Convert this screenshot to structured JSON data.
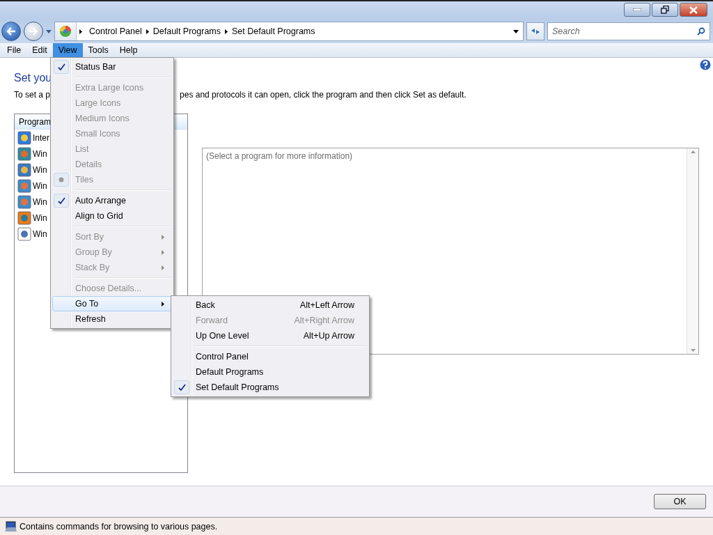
{
  "address_bar": {
    "breadcrumbs": [
      "Control Panel",
      "Default Programs",
      "Set Default Programs"
    ]
  },
  "search": {
    "placeholder": "Search"
  },
  "menu_bar": [
    {
      "label": "File",
      "selected": false
    },
    {
      "label": "Edit",
      "selected": false
    },
    {
      "label": "View",
      "selected": true
    },
    {
      "label": "Tools",
      "selected": false
    },
    {
      "label": "Help",
      "selected": false
    }
  ],
  "page": {
    "heading": "Set you",
    "description_left": "To set a p",
    "description_right": "pes and protocols it can open, click the program and then click Set as default.",
    "program_list": {
      "header": "Program",
      "items": [
        {
          "name": "Inter",
          "kind": "browser"
        },
        {
          "name": "Win",
          "kind": "gallery"
        },
        {
          "name": "Win",
          "kind": "contacts"
        },
        {
          "name": "Win",
          "kind": "mail"
        },
        {
          "name": "Win",
          "kind": "mail"
        },
        {
          "name": "Win",
          "kind": "player"
        },
        {
          "name": "Win",
          "kind": "document"
        }
      ]
    },
    "info_box": {
      "placeholder": "(Select a program for more information)"
    },
    "ok_button": "OK"
  },
  "view_menu": [
    [
      {
        "label": "Status Bar",
        "kind": "check",
        "checked": true,
        "disabled": false,
        "selected": false
      }
    ],
    [
      {
        "label": "Extra Large Icons",
        "kind": "radio",
        "checked": false,
        "disabled": true,
        "selected": false
      },
      {
        "label": "Large Icons",
        "kind": "radio",
        "checked": false,
        "disabled": true,
        "selected": false
      },
      {
        "label": "Medium Icons",
        "kind": "radio",
        "checked": false,
        "disabled": true,
        "selected": false
      },
      {
        "label": "Small Icons",
        "kind": "radio",
        "checked": false,
        "disabled": true,
        "selected": false
      },
      {
        "label": "List",
        "kind": "radio",
        "checked": false,
        "disabled": true,
        "selected": false
      },
      {
        "label": "Details",
        "kind": "radio",
        "checked": false,
        "disabled": true,
        "selected": false
      },
      {
        "label": "Tiles",
        "kind": "radio",
        "checked": true,
        "disabled": true,
        "selected": false
      }
    ],
    [
      {
        "label": "Auto Arrange",
        "kind": "check",
        "checked": true,
        "disabled": false,
        "selected": false
      },
      {
        "label": "Align to Grid",
        "kind": "check",
        "checked": false,
        "disabled": false,
        "selected": false
      }
    ],
    [
      {
        "label": "Sort By",
        "kind": "submenu",
        "checked": false,
        "disabled": true,
        "selected": false
      },
      {
        "label": "Group By",
        "kind": "submenu",
        "checked": false,
        "disabled": true,
        "selected": false
      },
      {
        "label": "Stack By",
        "kind": "submenu",
        "checked": false,
        "disabled": true,
        "selected": false
      }
    ],
    [
      {
        "label": "Choose Details...",
        "kind": "command",
        "checked": false,
        "disabled": true,
        "selected": false
      },
      {
        "label": "Go To",
        "kind": "submenu",
        "checked": false,
        "disabled": false,
        "selected": true
      },
      {
        "label": "Refresh",
        "kind": "command",
        "checked": false,
        "disabled": false,
        "selected": false
      }
    ]
  ],
  "goto_menu": [
    [
      {
        "label": "Back",
        "shortcut": "Alt+Left Arrow",
        "checked": false,
        "disabled": false
      },
      {
        "label": "Forward",
        "shortcut": "Alt+Right Arrow",
        "checked": false,
        "disabled": true
      },
      {
        "label": "Up One Level",
        "shortcut": "Alt+Up Arrow",
        "checked": false,
        "disabled": false
      }
    ],
    [
      {
        "label": "Control Panel",
        "checked": false,
        "disabled": false
      },
      {
        "label": "Default Programs",
        "checked": false,
        "disabled": false
      },
      {
        "label": "Set Default Programs",
        "checked": true,
        "disabled": false
      }
    ]
  ],
  "status_bar": {
    "text": "Contains commands for browsing to various pages."
  }
}
